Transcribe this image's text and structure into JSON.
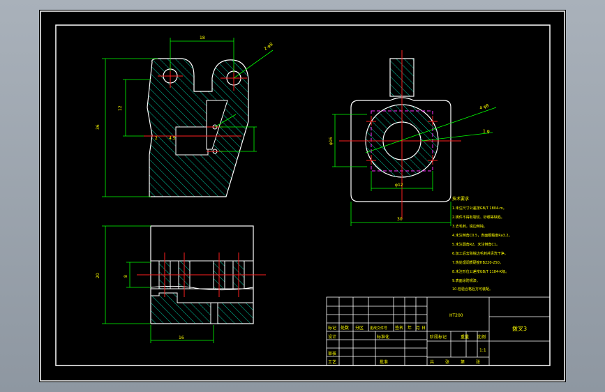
{
  "colors": {
    "background": "#000000",
    "frame": "#ffffff",
    "outline": "#ffffff",
    "hatch": "#00c8a0",
    "dimension": "#00ff00",
    "centerline": "#ff2020",
    "hidden": "#ff30ff",
    "text": "#ffff00"
  },
  "front_view": {
    "dim_top": "18",
    "dim_height": "36",
    "dim_inner": "12",
    "dim_small_a": "2",
    "dim_small_b": "4.5",
    "leader_note": "2-φ8"
  },
  "side_view": {
    "dim_width": "30",
    "dim_bore": "φ12",
    "dim_height": "φ16",
    "note_a": "4 φ8",
    "note_b": "1 φ"
  },
  "bottom_view": {
    "dim_height": "20",
    "dim_left": "8",
    "dim_width": "16"
  },
  "tech_notes": {
    "title": "技术要求",
    "lines": [
      "1.未注尺寸公差按GB/T 1804-m。",
      "2.铸件不得有裂纹、砂眼等缺陷。",
      "3.去毛刺，锐边倒钝。",
      "4.未注倒角C0.5，表面粗糙度Ra3.2。",
      "5.未注圆角R2，未注倒角C1。",
      "6.加工后去除锐边毛刺并清洗干净。",
      "7.热处理调质硬度HB220-250。",
      "8.未注形位公差按GB/T 1184-K级。",
      "9.表面涂防锈漆。",
      "10.检验合格后方可装配。"
    ]
  },
  "title_block": {
    "drawing_name": "拨叉",
    "material": "HT200",
    "drawing_no": "拨叉3",
    "scale": "1:1",
    "headers": [
      "标记",
      "处数",
      "分区",
      "更改文件号",
      "签名",
      "年",
      "月",
      "日"
    ],
    "rows_left": [
      "设计",
      "审核",
      "工艺"
    ],
    "standardization": "标准化",
    "approve": "批准",
    "stage_label": "阶段标记",
    "weight_label": "重量",
    "scale_label": "比例",
    "sheet_total": "共",
    "sheet_label": "张",
    "sheet_no": "第",
    "sheet_label2": "张"
  }
}
